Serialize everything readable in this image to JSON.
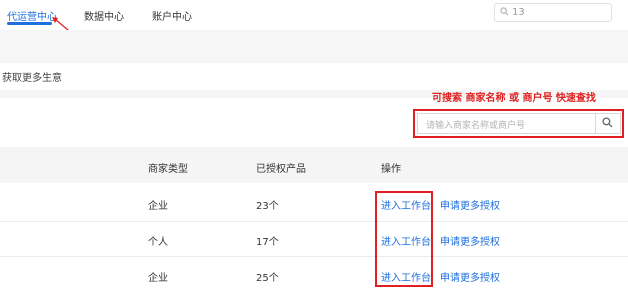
{
  "nav": {
    "tabs": [
      {
        "label": "代运营中心",
        "active": true
      },
      {
        "label": "数据中心",
        "active": false
      },
      {
        "label": "账户中心",
        "active": false
      }
    ],
    "search_value": "13"
  },
  "section": {
    "title": "获取更多生意"
  },
  "annotation": {
    "text": "可搜索 商家名称 或 商户号 快速查找",
    "color": "#e02020"
  },
  "search": {
    "placeholder": "请输入商家名称或商户号"
  },
  "table": {
    "headers": [
      "商家类型",
      "已授权产品",
      "操作"
    ],
    "rows": [
      {
        "type": "企业",
        "count": "23个",
        "enter": "进入工作台",
        "apply": "申请更多授权"
      },
      {
        "type": "个人",
        "count": "17个",
        "enter": "进入工作台",
        "apply": "申请更多授权"
      },
      {
        "type": "企业",
        "count": "25个",
        "enter": "进入工作台",
        "apply": "申请更多授权"
      }
    ]
  },
  "colors": {
    "accent": "#1f6fe0",
    "annotation": "#e02020"
  }
}
